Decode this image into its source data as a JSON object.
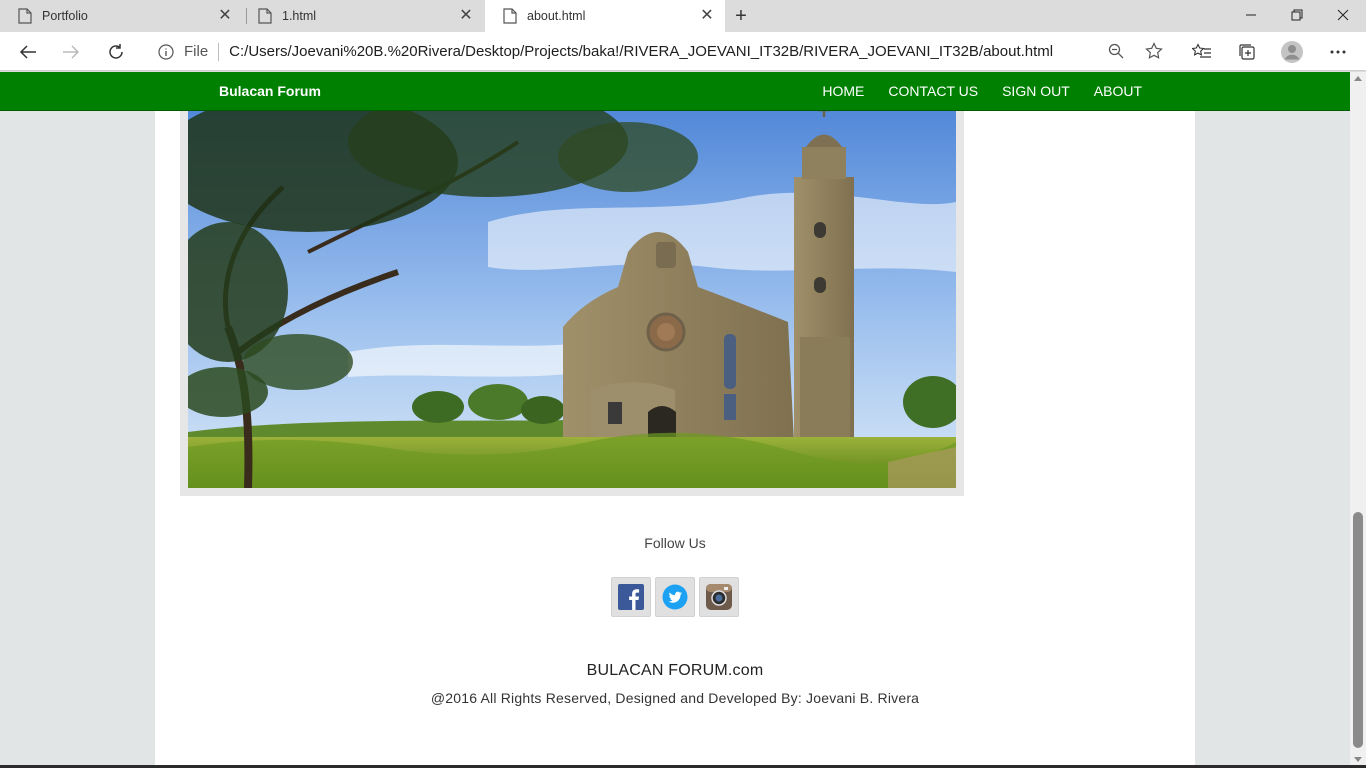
{
  "browser": {
    "tabs": [
      {
        "title": "Portfolio",
        "active": false
      },
      {
        "title": "1.html",
        "active": false
      },
      {
        "title": "about.html",
        "active": true
      }
    ],
    "address": {
      "scheme": "File",
      "url": "C:/Users/Joevani%20B.%20Rivera/Desktop/Projects/baka!/RIVERA_JOEVANI_IT32B/RIVERA_JOEVANI_IT32B/about.html"
    },
    "icons": {
      "back": "back-arrow-icon",
      "forward": "forward-arrow-icon",
      "refresh": "refresh-icon",
      "info": "info-icon",
      "zoom": "zoom-icon",
      "favorite": "star-icon",
      "favorites_list": "favorites-list-icon",
      "collections": "collections-icon",
      "profile": "profile-icon",
      "menu": "more-icon"
    }
  },
  "site": {
    "brand": "Bulacan Forum",
    "nav": [
      "HOME",
      "CONTACT US",
      "SIGN OUT",
      "ABOUT"
    ],
    "follow_label": "Follow Us",
    "social": [
      "facebook-icon",
      "twitter-icon",
      "instagram-icon"
    ],
    "footer_brand": "BULACAN FORUM.com",
    "footer_copy": "@2016 All Rights Reserved, Designed and Developed By: Joevani B. Rivera",
    "colors": {
      "nav_bg": "#008000",
      "page_bg": "#e1e5e6"
    }
  }
}
